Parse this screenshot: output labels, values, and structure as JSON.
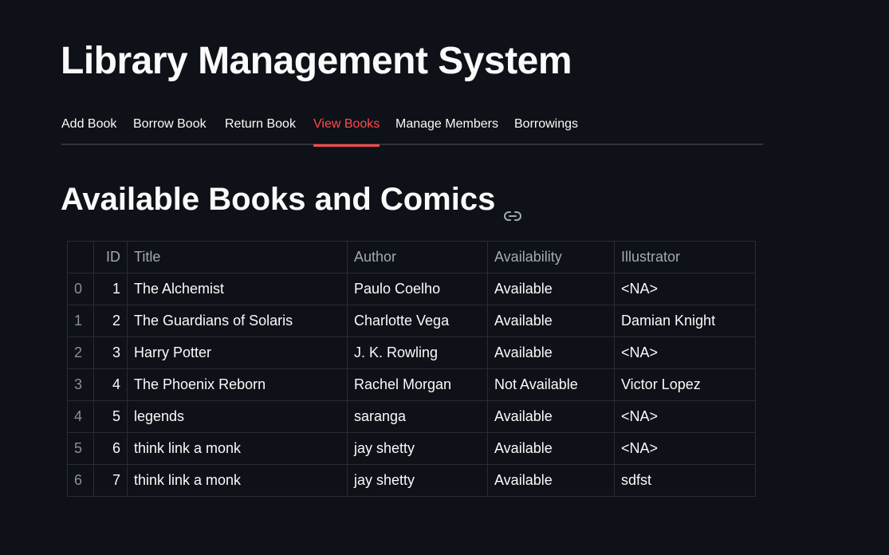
{
  "app": {
    "title": "Library Management System"
  },
  "tabs": [
    {
      "label": "Add Book",
      "active": false
    },
    {
      "label": "Borrow Book",
      "active": false
    },
    {
      "label": "Return Book",
      "active": false
    },
    {
      "label": "View Books",
      "active": true
    },
    {
      "label": "Manage Members",
      "active": false
    },
    {
      "label": "Borrowings",
      "active": false
    }
  ],
  "section": {
    "heading": "Available Books and Comics",
    "icon": "link-icon"
  },
  "colors": {
    "background": "#0e1117",
    "accent": "#ff4b4b",
    "text": "#fafafa"
  },
  "table": {
    "columns": [
      "",
      "ID",
      "Title",
      "Author",
      "Availability",
      "Illustrator"
    ],
    "rows": [
      [
        "0",
        "1",
        "The Alchemist",
        "Paulo Coelho",
        "Available",
        "<NA>"
      ],
      [
        "1",
        "2",
        "The Guardians of Solaris",
        "Charlotte Vega",
        "Available",
        "Damian Knight"
      ],
      [
        "2",
        "3",
        "Harry Potter",
        "J. K. Rowling",
        "Available",
        "<NA>"
      ],
      [
        "3",
        "4",
        "The Phoenix Reborn",
        "Rachel Morgan",
        "Not Available",
        "Victor Lopez"
      ],
      [
        "4",
        "5",
        "legends",
        "saranga",
        "Available",
        "<NA>"
      ],
      [
        "5",
        "6",
        "think link a monk",
        "jay shetty",
        "Available",
        "<NA>"
      ],
      [
        "6",
        "7",
        "think link a monk",
        "jay shetty",
        "Available",
        "sdfst"
      ]
    ]
  }
}
